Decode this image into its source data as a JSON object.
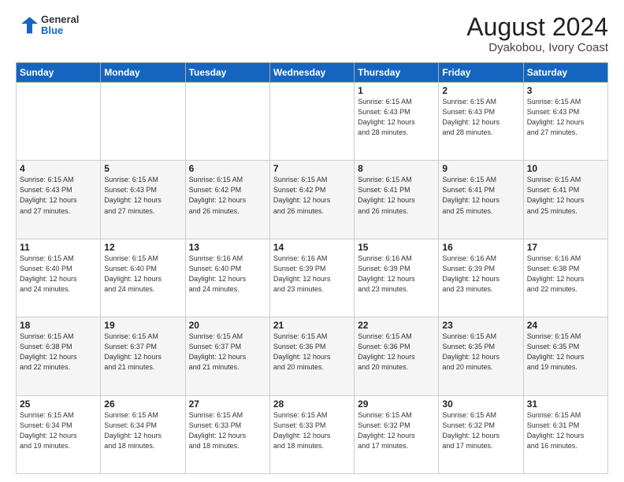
{
  "header": {
    "logo_line1": "General",
    "logo_line2": "Blue",
    "month_year": "August 2024",
    "location": "Dyakobou, Ivory Coast"
  },
  "days_of_week": [
    "Sunday",
    "Monday",
    "Tuesday",
    "Wednesday",
    "Thursday",
    "Friday",
    "Saturday"
  ],
  "weeks": [
    [
      {
        "day": "",
        "info": ""
      },
      {
        "day": "",
        "info": ""
      },
      {
        "day": "",
        "info": ""
      },
      {
        "day": "",
        "info": ""
      },
      {
        "day": "1",
        "info": "Sunrise: 6:15 AM\nSunset: 6:43 PM\nDaylight: 12 hours\nand 28 minutes."
      },
      {
        "day": "2",
        "info": "Sunrise: 6:15 AM\nSunset: 6:43 PM\nDaylight: 12 hours\nand 28 minutes."
      },
      {
        "day": "3",
        "info": "Sunrise: 6:15 AM\nSunset: 6:43 PM\nDaylight: 12 hours\nand 27 minutes."
      }
    ],
    [
      {
        "day": "4",
        "info": "Sunrise: 6:15 AM\nSunset: 6:43 PM\nDaylight: 12 hours\nand 27 minutes."
      },
      {
        "day": "5",
        "info": "Sunrise: 6:15 AM\nSunset: 6:43 PM\nDaylight: 12 hours\nand 27 minutes."
      },
      {
        "day": "6",
        "info": "Sunrise: 6:15 AM\nSunset: 6:42 PM\nDaylight: 12 hours\nand 26 minutes."
      },
      {
        "day": "7",
        "info": "Sunrise: 6:15 AM\nSunset: 6:42 PM\nDaylight: 12 hours\nand 26 minutes."
      },
      {
        "day": "8",
        "info": "Sunrise: 6:15 AM\nSunset: 6:41 PM\nDaylight: 12 hours\nand 26 minutes."
      },
      {
        "day": "9",
        "info": "Sunrise: 6:15 AM\nSunset: 6:41 PM\nDaylight: 12 hours\nand 25 minutes."
      },
      {
        "day": "10",
        "info": "Sunrise: 6:15 AM\nSunset: 6:41 PM\nDaylight: 12 hours\nand 25 minutes."
      }
    ],
    [
      {
        "day": "11",
        "info": "Sunrise: 6:15 AM\nSunset: 6:40 PM\nDaylight: 12 hours\nand 24 minutes."
      },
      {
        "day": "12",
        "info": "Sunrise: 6:15 AM\nSunset: 6:40 PM\nDaylight: 12 hours\nand 24 minutes."
      },
      {
        "day": "13",
        "info": "Sunrise: 6:16 AM\nSunset: 6:40 PM\nDaylight: 12 hours\nand 24 minutes."
      },
      {
        "day": "14",
        "info": "Sunrise: 6:16 AM\nSunset: 6:39 PM\nDaylight: 12 hours\nand 23 minutes."
      },
      {
        "day": "15",
        "info": "Sunrise: 6:16 AM\nSunset: 6:39 PM\nDaylight: 12 hours\nand 23 minutes."
      },
      {
        "day": "16",
        "info": "Sunrise: 6:16 AM\nSunset: 6:39 PM\nDaylight: 12 hours\nand 23 minutes."
      },
      {
        "day": "17",
        "info": "Sunrise: 6:16 AM\nSunset: 6:38 PM\nDaylight: 12 hours\nand 22 minutes."
      }
    ],
    [
      {
        "day": "18",
        "info": "Sunrise: 6:15 AM\nSunset: 6:38 PM\nDaylight: 12 hours\nand 22 minutes."
      },
      {
        "day": "19",
        "info": "Sunrise: 6:15 AM\nSunset: 6:37 PM\nDaylight: 12 hours\nand 21 minutes."
      },
      {
        "day": "20",
        "info": "Sunrise: 6:15 AM\nSunset: 6:37 PM\nDaylight: 12 hours\nand 21 minutes."
      },
      {
        "day": "21",
        "info": "Sunrise: 6:15 AM\nSunset: 6:36 PM\nDaylight: 12 hours\nand 20 minutes."
      },
      {
        "day": "22",
        "info": "Sunrise: 6:15 AM\nSunset: 6:36 PM\nDaylight: 12 hours\nand 20 minutes."
      },
      {
        "day": "23",
        "info": "Sunrise: 6:15 AM\nSunset: 6:35 PM\nDaylight: 12 hours\nand 20 minutes."
      },
      {
        "day": "24",
        "info": "Sunrise: 6:15 AM\nSunset: 6:35 PM\nDaylight: 12 hours\nand 19 minutes."
      }
    ],
    [
      {
        "day": "25",
        "info": "Sunrise: 6:15 AM\nSunset: 6:34 PM\nDaylight: 12 hours\nand 19 minutes."
      },
      {
        "day": "26",
        "info": "Sunrise: 6:15 AM\nSunset: 6:34 PM\nDaylight: 12 hours\nand 18 minutes."
      },
      {
        "day": "27",
        "info": "Sunrise: 6:15 AM\nSunset: 6:33 PM\nDaylight: 12 hours\nand 18 minutes."
      },
      {
        "day": "28",
        "info": "Sunrise: 6:15 AM\nSunset: 6:33 PM\nDaylight: 12 hours\nand 18 minutes."
      },
      {
        "day": "29",
        "info": "Sunrise: 6:15 AM\nSunset: 6:32 PM\nDaylight: 12 hours\nand 17 minutes."
      },
      {
        "day": "30",
        "info": "Sunrise: 6:15 AM\nSunset: 6:32 PM\nDaylight: 12 hours\nand 17 minutes."
      },
      {
        "day": "31",
        "info": "Sunrise: 6:15 AM\nSunset: 6:31 PM\nDaylight: 12 hours\nand 16 minutes."
      }
    ]
  ]
}
